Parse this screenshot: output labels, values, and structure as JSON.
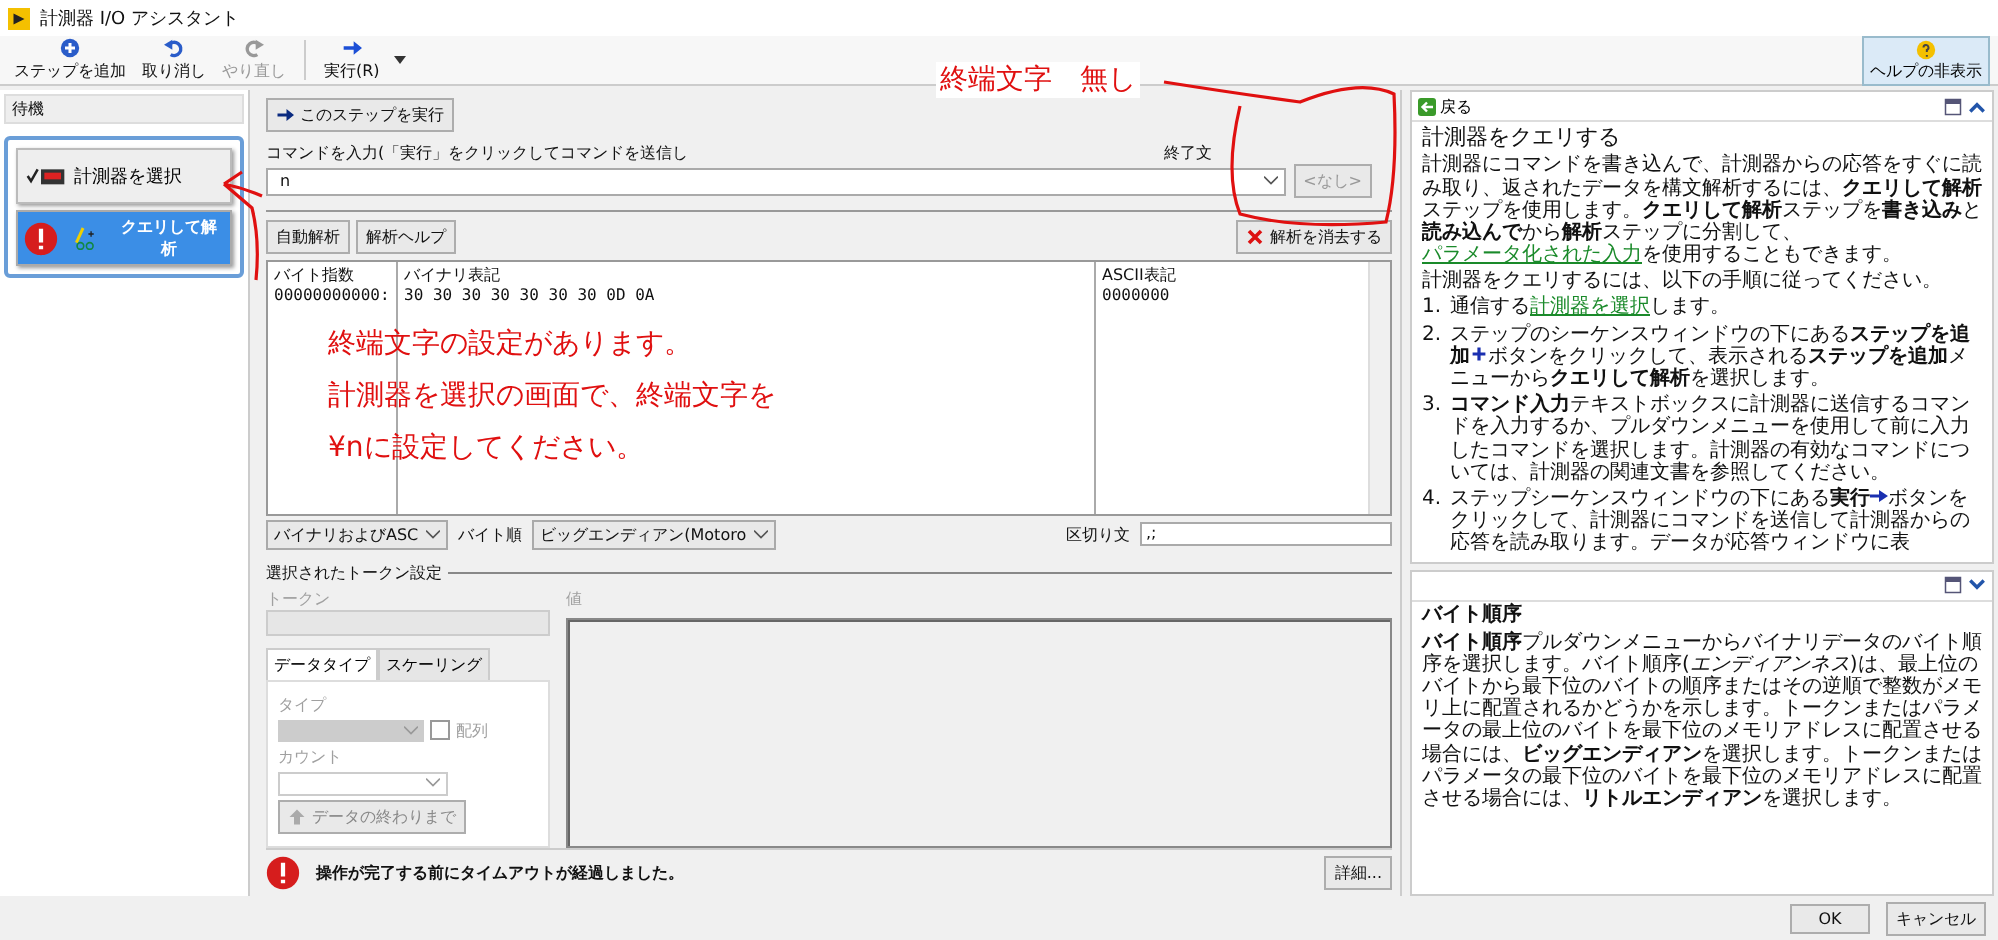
{
  "window": {
    "title": "計測器 I/O アシスタント"
  },
  "toolbar": [
    {
      "label": "ステップを追加",
      "kind": "add",
      "disabled": false
    },
    {
      "label": "取り消し",
      "kind": "undo",
      "disabled": false
    },
    {
      "label": "やり直し",
      "kind": "redo",
      "disabled": true
    },
    {
      "label": "実行(R)",
      "kind": "run",
      "disabled": false
    }
  ],
  "help_toggle": "ヘルプの非表示",
  "steps_panel": {
    "header": "待機",
    "steps": [
      {
        "label": "計測器を選択",
        "kind": "done",
        "selected": false
      },
      {
        "label": "クエリして解析",
        "kind": "error",
        "selected": true
      }
    ]
  },
  "main": {
    "run_step_button": "このステップを実行",
    "command_label": "コマンドを入力(「実行」をクリックしてコマンドを送信し",
    "command_value": "n",
    "terminator_label": "終了文",
    "terminator_button": {
      "label": "<なし>",
      "disabled": true
    },
    "auto_parse_button": "自動解析",
    "parse_help_button": "解析ヘルプ",
    "clear_parse_button": "解析を消去する",
    "hex": {
      "columns": [
        "バイト指数",
        "バイナリ表記",
        "ASCII表記"
      ],
      "row": [
        "00000000000:",
        "30 30 30 30 30 30 30 0D 0A",
        "0000000"
      ]
    },
    "format_select": "バイナリおよびASC",
    "byte_order_label": "バイト順",
    "byte_order_select": "ビッグエンディアン(Motoro",
    "delimiter_label": "区切り文",
    "delimiter_value": ",;"
  },
  "token_settings": {
    "title": "選択されたトークン設定",
    "token_label": "トークン",
    "value_label": "値",
    "tabs": [
      {
        "label": "データタイプ",
        "selected": true
      },
      {
        "label": "スケーリング",
        "selected": false
      }
    ],
    "type_label": "タイプ",
    "array_label": "配列",
    "array_checked": false,
    "count_label": "カウント",
    "to_end_button": "データの終わりまで"
  },
  "status": {
    "message": "操作が完了する前にタイムアウトが経過しました。",
    "details_button": "詳細..."
  },
  "help": {
    "back": "戻る",
    "title": "計測器をクエリする",
    "paragraphs": [
      [
        {
          "kind": "text",
          "text": "計測器にコマンドを書き込んで、計測器からの応答をすぐに読み取り、返されたデータを構文解析するには、**クエリして解析**ステップを使用します。**クエリして解析**ステップを**書き込み**と**読み込んで**から**解析**ステップに分割して、"
        },
        {
          "kind": "link",
          "text": "パラメータ化された入力"
        },
        {
          "kind": "text",
          "text": "を使用することもできます。"
        }
      ],
      [
        {
          "kind": "text",
          "text": "計測器をクエリするには、以下の手順に従ってください。"
        }
      ]
    ],
    "steps": [
      {
        "number": "1.",
        "parts": [
          {
            "kind": "text",
            "text": "通信する"
          },
          {
            "kind": "link",
            "text": "計測器を選択"
          },
          {
            "kind": "text",
            "text": "します。"
          }
        ]
      },
      {
        "number": "2.",
        "parts": [
          {
            "kind": "text",
            "text": "ステップのシーケンスウィンドウの下にある**ステップを追加**"
          },
          {
            "kind": "plus"
          },
          {
            "kind": "text",
            "text": "ボタンをクリックして、表示される**ステップを追加**メニューから**クエリして解析**を選択します。"
          }
        ]
      },
      {
        "number": "3.",
        "parts": [
          {
            "kind": "text",
            "text": "**コマンド入力**テキストボックスに計測器に送信するコマンドを入力するか、プルダウンメニューを使用して前に入力したコマンドを選択します。計測器の有効なコマンドについては、計測器の関連文書を参照してください。"
          }
        ]
      },
      {
        "number": "4.",
        "parts": [
          {
            "kind": "text",
            "text": "ステップシーケンスウィンドウの下にある**実行**"
          },
          {
            "kind": "arrow"
          },
          {
            "kind": "text",
            "text": "ボタンをクリックして、計測器にコマンドを送信して計測器からの応答を読み取ります。データが応答ウィンドウに表"
          }
        ]
      }
    ],
    "context_title": "バイト順序",
    "context_text": "**バイト順序**プルダウンメニューからバイナリデータのバイト順序を選択します。バイト順序(*エンディアンネス*)は、最上位のバイトから最下位のバイトの順序またはその逆順で整数がメモリ上に配置されるかどうかを示します。トークンまたはパラメータの最上位のバイトを最下位のメモリアドレスに配置させる場合には、**ビッグエンディアン**を選択します。トークンまたはパラメータの最下位のバイトを最下位のメモリアドレスに配置させる場合には、**リトルエンディアン**を選択します。"
  },
  "footer": {
    "ok": "OK",
    "cancel": "キャンセル"
  },
  "annotations": {
    "top_note": "終端文字　無し",
    "body_lines": [
      "終端文字の設定があります。",
      "計測器を選択の画面で、終端文字を",
      "¥nに設定してください。"
    ]
  }
}
